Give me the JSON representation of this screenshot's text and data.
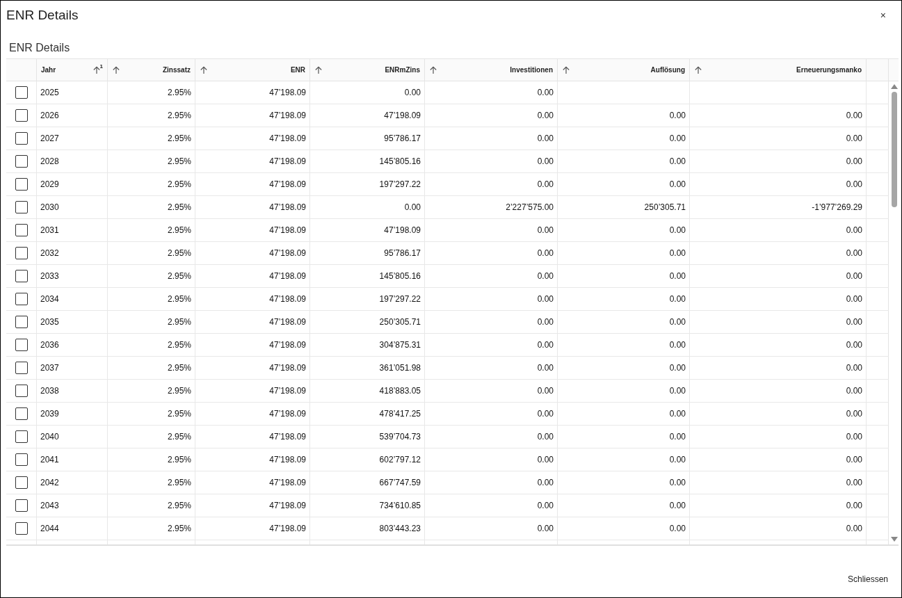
{
  "dialog": {
    "title": "ENR Details",
    "close": "×"
  },
  "table": {
    "title": "ENR Details",
    "columns": [
      {
        "label": "Jahr",
        "kind": "text",
        "sort_order": "1"
      },
      {
        "label": "Zinssatz",
        "kind": "number"
      },
      {
        "label": "ENR",
        "kind": "number"
      },
      {
        "label": "ENRmZins",
        "kind": "number"
      },
      {
        "label": "Investitionen",
        "kind": "number"
      },
      {
        "label": "Auflösung",
        "kind": "number"
      },
      {
        "label": "Erneuerungsmanko",
        "kind": "number"
      }
    ],
    "rows": [
      {
        "checked": false,
        "cells": [
          "2025",
          "2.95%",
          "47’198.09",
          "0.00",
          "0.00",
          null,
          null
        ]
      },
      {
        "checked": false,
        "cells": [
          "2026",
          "2.95%",
          "47’198.09",
          "47’198.09",
          "0.00",
          "0.00",
          "0.00"
        ]
      },
      {
        "checked": false,
        "cells": [
          "2027",
          "2.95%",
          "47’198.09",
          "95’786.17",
          "0.00",
          "0.00",
          "0.00"
        ]
      },
      {
        "checked": false,
        "cells": [
          "2028",
          "2.95%",
          "47’198.09",
          "145’805.16",
          "0.00",
          "0.00",
          "0.00"
        ]
      },
      {
        "checked": false,
        "cells": [
          "2029",
          "2.95%",
          "47’198.09",
          "197’297.22",
          "0.00",
          "0.00",
          "0.00"
        ]
      },
      {
        "checked": false,
        "cells": [
          "2030",
          "2.95%",
          "47’198.09",
          "0.00",
          "2’227’575.00",
          "250’305.71",
          "-1’977’269.29"
        ]
      },
      {
        "checked": false,
        "cells": [
          "2031",
          "2.95%",
          "47’198.09",
          "47’198.09",
          "0.00",
          "0.00",
          "0.00"
        ]
      },
      {
        "checked": false,
        "cells": [
          "2032",
          "2.95%",
          "47’198.09",
          "95’786.17",
          "0.00",
          "0.00",
          "0.00"
        ]
      },
      {
        "checked": false,
        "cells": [
          "2033",
          "2.95%",
          "47’198.09",
          "145’805.16",
          "0.00",
          "0.00",
          "0.00"
        ]
      },
      {
        "checked": false,
        "cells": [
          "2034",
          "2.95%",
          "47’198.09",
          "197’297.22",
          "0.00",
          "0.00",
          "0.00"
        ]
      },
      {
        "checked": false,
        "cells": [
          "2035",
          "2.95%",
          "47’198.09",
          "250’305.71",
          "0.00",
          "0.00",
          "0.00"
        ]
      },
      {
        "checked": false,
        "cells": [
          "2036",
          "2.95%",
          "47’198.09",
          "304’875.31",
          "0.00",
          "0.00",
          "0.00"
        ]
      },
      {
        "checked": false,
        "cells": [
          "2037",
          "2.95%",
          "47’198.09",
          "361’051.98",
          "0.00",
          "0.00",
          "0.00"
        ]
      },
      {
        "checked": false,
        "cells": [
          "2038",
          "2.95%",
          "47’198.09",
          "418’883.05",
          "0.00",
          "0.00",
          "0.00"
        ]
      },
      {
        "checked": false,
        "cells": [
          "2039",
          "2.95%",
          "47’198.09",
          "478’417.25",
          "0.00",
          "0.00",
          "0.00"
        ]
      },
      {
        "checked": false,
        "cells": [
          "2040",
          "2.95%",
          "47’198.09",
          "539’704.73",
          "0.00",
          "0.00",
          "0.00"
        ]
      },
      {
        "checked": false,
        "cells": [
          "2041",
          "2.95%",
          "47’198.09",
          "602’797.12",
          "0.00",
          "0.00",
          "0.00"
        ]
      },
      {
        "checked": false,
        "cells": [
          "2042",
          "2.95%",
          "47’198.09",
          "667’747.59",
          "0.00",
          "0.00",
          "0.00"
        ]
      },
      {
        "checked": false,
        "cells": [
          "2043",
          "2.95%",
          "47’198.09",
          "734’610.85",
          "0.00",
          "0.00",
          "0.00"
        ]
      },
      {
        "checked": false,
        "cells": [
          "2044",
          "2.95%",
          "47’198.09",
          "803’443.23",
          "0.00",
          "0.00",
          "0.00"
        ]
      }
    ]
  },
  "footer": {
    "button": "Schliessen"
  }
}
